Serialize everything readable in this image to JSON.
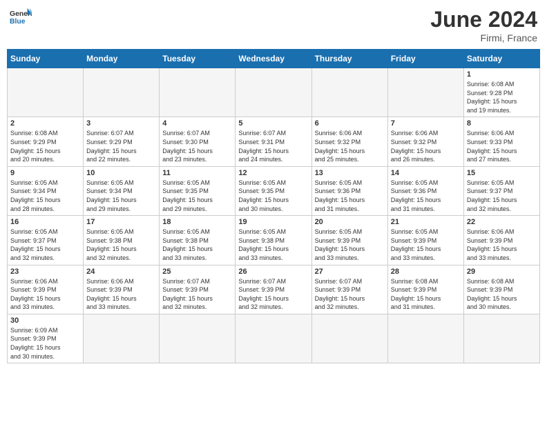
{
  "header": {
    "logo_general": "General",
    "logo_blue": "Blue",
    "month_year": "June 2024",
    "location": "Firmi, France"
  },
  "weekdays": [
    "Sunday",
    "Monday",
    "Tuesday",
    "Wednesday",
    "Thursday",
    "Friday",
    "Saturday"
  ],
  "days": {
    "d1": {
      "num": "1",
      "sunrise": "6:08 AM",
      "sunset": "9:28 PM",
      "daylight": "15 hours and 19 minutes."
    },
    "d2": {
      "num": "2",
      "sunrise": "6:08 AM",
      "sunset": "9:29 PM",
      "daylight": "15 hours and 20 minutes."
    },
    "d3": {
      "num": "3",
      "sunrise": "6:07 AM",
      "sunset": "9:29 PM",
      "daylight": "15 hours and 22 minutes."
    },
    "d4": {
      "num": "4",
      "sunrise": "6:07 AM",
      "sunset": "9:30 PM",
      "daylight": "15 hours and 23 minutes."
    },
    "d5": {
      "num": "5",
      "sunrise": "6:07 AM",
      "sunset": "9:31 PM",
      "daylight": "15 hours and 24 minutes."
    },
    "d6": {
      "num": "6",
      "sunrise": "6:06 AM",
      "sunset": "9:32 PM",
      "daylight": "15 hours and 25 minutes."
    },
    "d7": {
      "num": "7",
      "sunrise": "6:06 AM",
      "sunset": "9:32 PM",
      "daylight": "15 hours and 26 minutes."
    },
    "d8": {
      "num": "8",
      "sunrise": "6:06 AM",
      "sunset": "9:33 PM",
      "daylight": "15 hours and 27 minutes."
    },
    "d9": {
      "num": "9",
      "sunrise": "6:05 AM",
      "sunset": "9:34 PM",
      "daylight": "15 hours and 28 minutes."
    },
    "d10": {
      "num": "10",
      "sunrise": "6:05 AM",
      "sunset": "9:34 PM",
      "daylight": "15 hours and 29 minutes."
    },
    "d11": {
      "num": "11",
      "sunrise": "6:05 AM",
      "sunset": "9:35 PM",
      "daylight": "15 hours and 29 minutes."
    },
    "d12": {
      "num": "12",
      "sunrise": "6:05 AM",
      "sunset": "9:35 PM",
      "daylight": "15 hours and 30 minutes."
    },
    "d13": {
      "num": "13",
      "sunrise": "6:05 AM",
      "sunset": "9:36 PM",
      "daylight": "15 hours and 31 minutes."
    },
    "d14": {
      "num": "14",
      "sunrise": "6:05 AM",
      "sunset": "9:36 PM",
      "daylight": "15 hours and 31 minutes."
    },
    "d15": {
      "num": "15",
      "sunrise": "6:05 AM",
      "sunset": "9:37 PM",
      "daylight": "15 hours and 32 minutes."
    },
    "d16": {
      "num": "16",
      "sunrise": "6:05 AM",
      "sunset": "9:37 PM",
      "daylight": "15 hours and 32 minutes."
    },
    "d17": {
      "num": "17",
      "sunrise": "6:05 AM",
      "sunset": "9:38 PM",
      "daylight": "15 hours and 32 minutes."
    },
    "d18": {
      "num": "18",
      "sunrise": "6:05 AM",
      "sunset": "9:38 PM",
      "daylight": "15 hours and 33 minutes."
    },
    "d19": {
      "num": "19",
      "sunrise": "6:05 AM",
      "sunset": "9:38 PM",
      "daylight": "15 hours and 33 minutes."
    },
    "d20": {
      "num": "20",
      "sunrise": "6:05 AM",
      "sunset": "9:39 PM",
      "daylight": "15 hours and 33 minutes."
    },
    "d21": {
      "num": "21",
      "sunrise": "6:05 AM",
      "sunset": "9:39 PM",
      "daylight": "15 hours and 33 minutes."
    },
    "d22": {
      "num": "22",
      "sunrise": "6:06 AM",
      "sunset": "9:39 PM",
      "daylight": "15 hours and 33 minutes."
    },
    "d23": {
      "num": "23",
      "sunrise": "6:06 AM",
      "sunset": "9:39 PM",
      "daylight": "15 hours and 33 minutes."
    },
    "d24": {
      "num": "24",
      "sunrise": "6:06 AM",
      "sunset": "9:39 PM",
      "daylight": "15 hours and 33 minutes."
    },
    "d25": {
      "num": "25",
      "sunrise": "6:07 AM",
      "sunset": "9:39 PM",
      "daylight": "15 hours and 32 minutes."
    },
    "d26": {
      "num": "26",
      "sunrise": "6:07 AM",
      "sunset": "9:39 PM",
      "daylight": "15 hours and 32 minutes."
    },
    "d27": {
      "num": "27",
      "sunrise": "6:07 AM",
      "sunset": "9:39 PM",
      "daylight": "15 hours and 32 minutes."
    },
    "d28": {
      "num": "28",
      "sunrise": "6:08 AM",
      "sunset": "9:39 PM",
      "daylight": "15 hours and 31 minutes."
    },
    "d29": {
      "num": "29",
      "sunrise": "6:08 AM",
      "sunset": "9:39 PM",
      "daylight": "15 hours and 30 minutes."
    },
    "d30": {
      "num": "30",
      "sunrise": "6:09 AM",
      "sunset": "9:39 PM",
      "daylight": "15 hours and 30 minutes."
    }
  },
  "labels": {
    "sunrise": "Sunrise:",
    "sunset": "Sunset:",
    "daylight": "Daylight:"
  }
}
